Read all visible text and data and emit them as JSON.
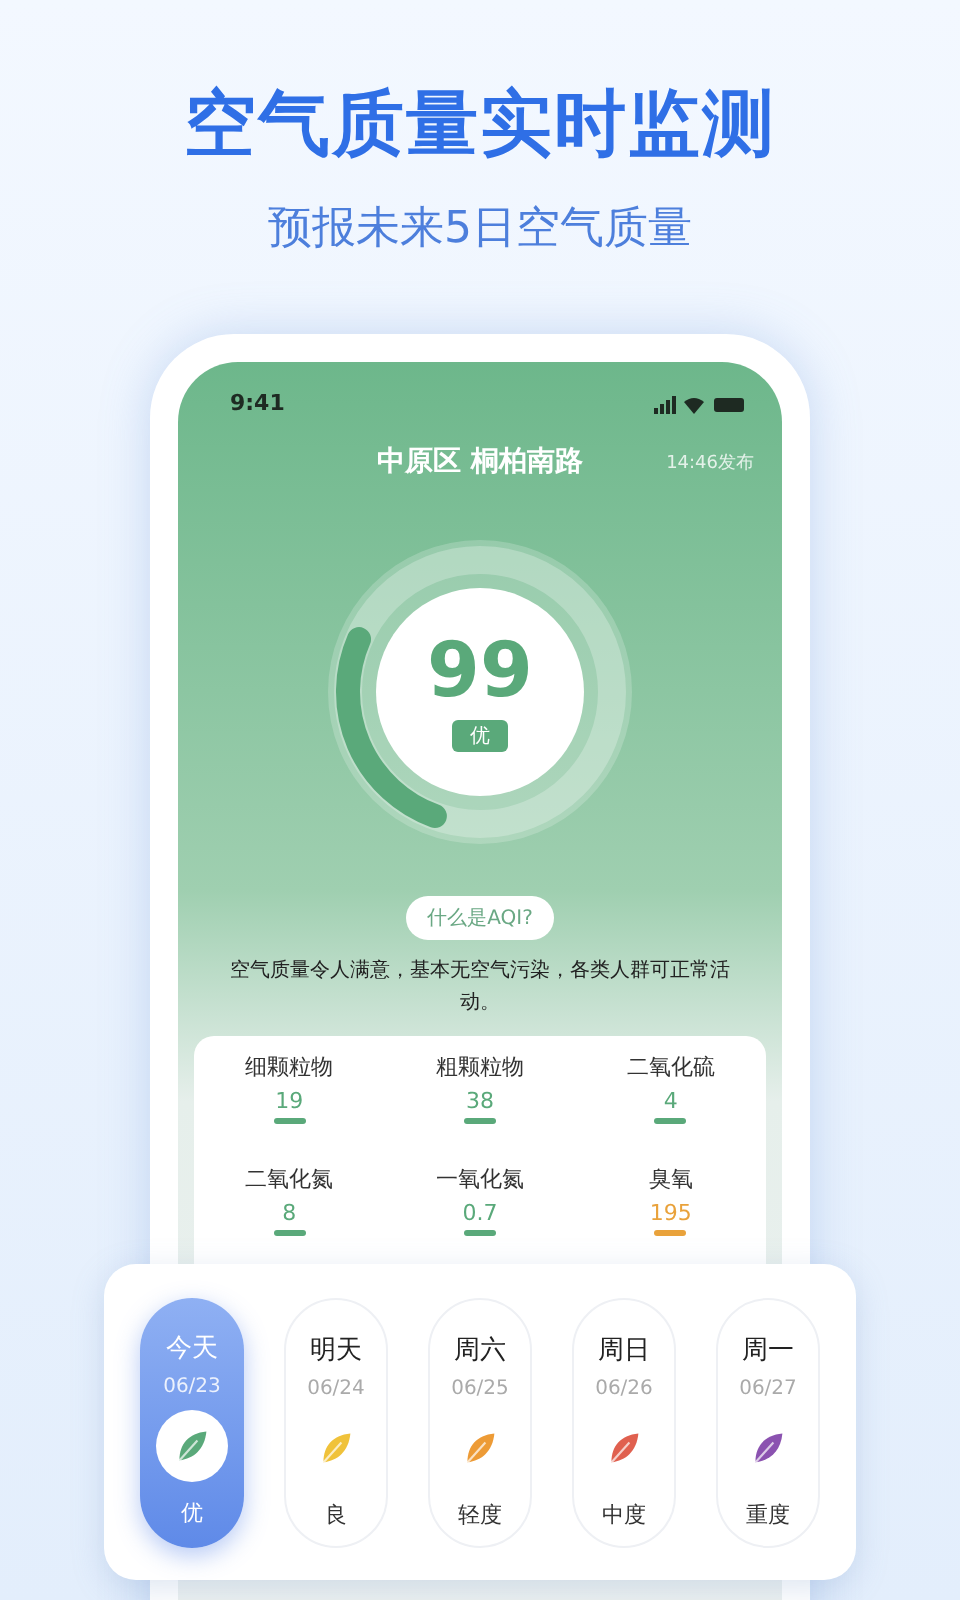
{
  "headline": "空气质量实时监测",
  "subtitle": "预报未来5日空气质量",
  "status_bar": {
    "time": "9:41"
  },
  "location": "中原区 桐柏南路",
  "published": "14:46发布",
  "aqi": {
    "value": "99",
    "grade": "优"
  },
  "aqi_help": "什么是AQI?",
  "description": "空气质量令人满意，基本无空气污染，各类人群可正常活动。",
  "pollutants": [
    {
      "name": "细颗粒物",
      "value": "19",
      "color": "#5aa97a"
    },
    {
      "name": "粗颗粒物",
      "value": "38",
      "color": "#5aa97a"
    },
    {
      "name": "二氧化硫",
      "value": "4",
      "color": "#5aa97a"
    },
    {
      "name": "二氧化氮",
      "value": "8",
      "color": "#5aa97a"
    },
    {
      "name": "一氧化氮",
      "value": "0.7",
      "color": "#5aa97a"
    },
    {
      "name": "臭氧",
      "value": "195",
      "color": "#e9a23b"
    }
  ],
  "forecast": [
    {
      "day": "今天",
      "date": "06/23",
      "grade": "优",
      "color": "#5aa97a",
      "selected": true
    },
    {
      "day": "明天",
      "date": "06/24",
      "grade": "良",
      "color": "#f0c23a",
      "selected": false
    },
    {
      "day": "周六",
      "date": "06/25",
      "grade": "轻度",
      "color": "#ed9b36",
      "selected": false
    },
    {
      "day": "周日",
      "date": "06/26",
      "grade": "中度",
      "color": "#e0604f",
      "selected": false
    },
    {
      "day": "周一",
      "date": "06/27",
      "grade": "重度",
      "color": "#8b52b0",
      "selected": false
    }
  ]
}
